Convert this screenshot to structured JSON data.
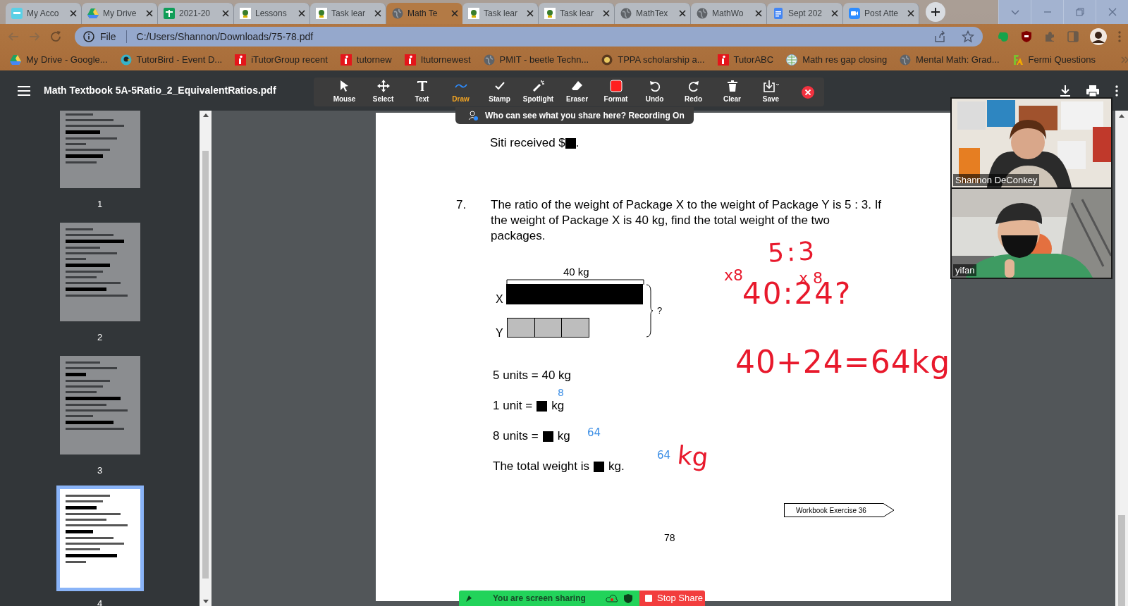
{
  "browser": {
    "tabs": [
      {
        "label": "My Acco",
        "selected": false
      },
      {
        "label": "My Drive",
        "selected": false
      },
      {
        "label": "2021-20",
        "selected": false
      },
      {
        "label": "Lessons",
        "selected": false
      },
      {
        "label": "Task lear",
        "selected": false
      },
      {
        "label": "Math Te",
        "selected": true
      },
      {
        "label": "Task lear",
        "selected": false
      },
      {
        "label": "Task lear",
        "selected": false
      },
      {
        "label": "MathTex",
        "selected": false
      },
      {
        "label": "MathWo",
        "selected": false
      },
      {
        "label": "Sept 202",
        "selected": false
      },
      {
        "label": "Post Atte",
        "selected": false
      }
    ],
    "address": {
      "scheme": "File",
      "url": "C:/Users/Shannon/Downloads/75-78.pdf"
    },
    "bookmarks": [
      "My Drive - Google...",
      "TutorBird - Event D...",
      "iTutorGroup recent",
      "tutornew",
      "Itutornewest",
      "PMIT - beetle Techn...",
      "TPPA scholarship a...",
      "TutorABC",
      "Math res gap closing",
      "Mental Math: Grad...",
      "Fermi Questions"
    ]
  },
  "pdf_viewer": {
    "title": "Math Textbook 5A-5Ratio_2_EquivalentRatios.pdf",
    "thumbnails": [
      {
        "label": "1",
        "selected": false
      },
      {
        "label": "2",
        "selected": false
      },
      {
        "label": "3",
        "selected": false
      },
      {
        "label": "4",
        "selected": true
      }
    ]
  },
  "annotation_toolbar": {
    "tools": [
      {
        "label": "Mouse",
        "selected": false
      },
      {
        "label": "Select",
        "selected": false
      },
      {
        "label": "Text",
        "selected": false
      },
      {
        "label": "Draw",
        "selected": true
      },
      {
        "label": "Stamp",
        "selected": false
      },
      {
        "label": "Spotlight",
        "selected": false
      },
      {
        "label": "Eraser",
        "selected": false
      },
      {
        "label": "Format",
        "selected": false
      },
      {
        "label": "Undo",
        "selected": false
      },
      {
        "label": "Redo",
        "selected": false
      },
      {
        "label": "Clear",
        "selected": false
      },
      {
        "label": "Save",
        "selected": false
      }
    ],
    "banner": "Who can see what you share here? Recording On"
  },
  "page": {
    "siti": {
      "before": "Siti received $",
      "after": "."
    },
    "question": {
      "number": "7.",
      "text": "The ratio of the weight of Package X to the weight of Package Y is 5 : 3. If the weight of Package X is 40 kg, find the total weight of the two packages."
    },
    "diagram": {
      "top_label": "40 kg",
      "row_x": "X",
      "row_y": "Y",
      "total": "?"
    },
    "lines": [
      {
        "before": "5 units = 40 kg"
      },
      {
        "before": "1 unit =",
        "after": "kg"
      },
      {
        "before": "8 units =",
        "after": "kg"
      },
      {
        "before": "The total weight is",
        "after": "kg."
      }
    ],
    "exercise_tag": "Workbook Exercise 36",
    "page_number": "78",
    "annotations": [
      {
        "text": "5:3",
        "color": "#e8192c"
      },
      {
        "text": "x8",
        "color": "#e8192c"
      },
      {
        "text": "x 8",
        "color": "#e8192c"
      },
      {
        "text": "40:24?",
        "color": "#e8192c"
      },
      {
        "text": "40+24=64kg",
        "color": "#e8192c"
      },
      {
        "text": "kg",
        "color": "#e8192c"
      },
      {
        "text": "8",
        "color": "#3d8fe6"
      },
      {
        "text": "64",
        "color": "#3d8fe6"
      },
      {
        "text": "64",
        "color": "#3d8fe6"
      }
    ]
  },
  "video": [
    {
      "name": "Shannon DeConkey"
    },
    {
      "name": "yifan"
    }
  ],
  "share_bar": {
    "status": "You are screen sharing",
    "button": "Stop Share"
  }
}
